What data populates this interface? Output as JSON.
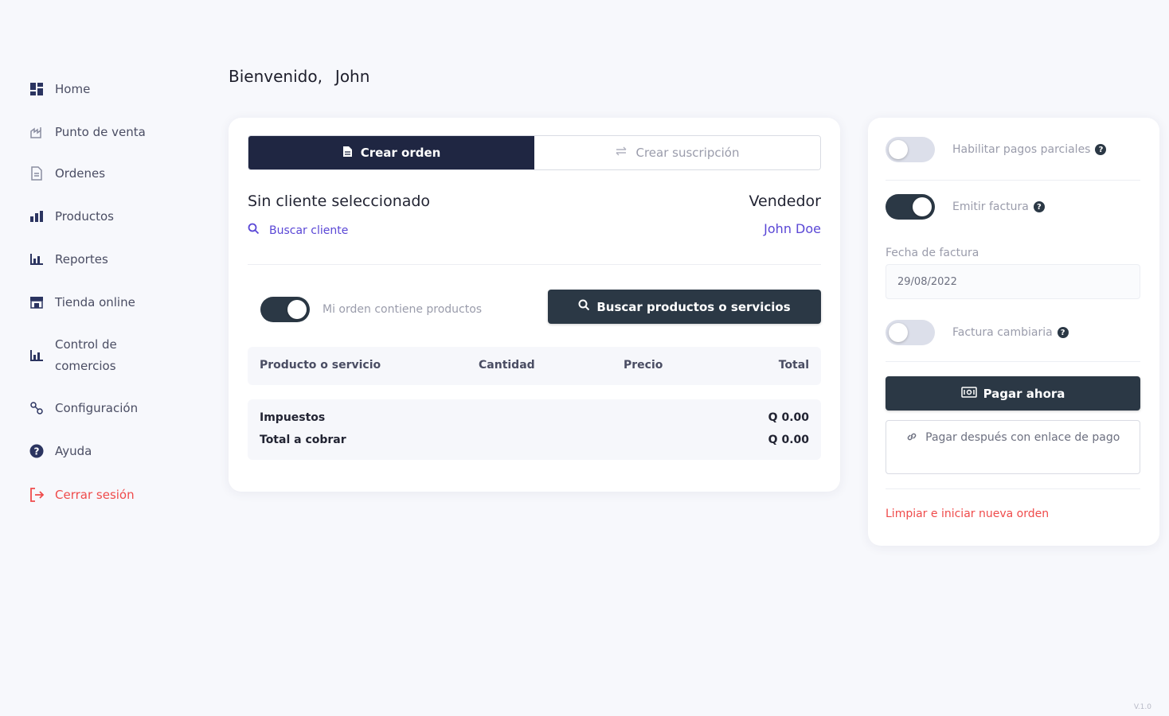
{
  "sidebar": {
    "items": [
      {
        "label": "Home",
        "icon": "dashboard-icon"
      },
      {
        "label": "Punto de venta",
        "icon": "store-icon"
      },
      {
        "label": "Ordenes",
        "icon": "document-icon"
      },
      {
        "label": "Productos",
        "icon": "products-icon"
      },
      {
        "label": "Reportes",
        "icon": "bar-chart-icon"
      },
      {
        "label": "Tienda online",
        "icon": "shop-icon"
      },
      {
        "label": "Control de comercios",
        "icon": "bar-chart-icon"
      },
      {
        "label": "Configuración",
        "icon": "settings-icon"
      },
      {
        "label": "Ayuda",
        "icon": "help-icon"
      },
      {
        "label": "Cerrar sesión",
        "icon": "logout-icon"
      }
    ]
  },
  "header": {
    "greeting": "Bienvenido,",
    "user_name": "John"
  },
  "order": {
    "tabs": [
      {
        "label": "Crear orden",
        "active": true
      },
      {
        "label": "Crear suscripción",
        "active": false
      }
    ],
    "client_status": "Sin cliente seleccionado",
    "search_client": "Buscar cliente",
    "seller_label": "Vendedor",
    "seller_name": "John Doe",
    "contains_products_label": "Mi orden contiene productos",
    "contains_products_on": true,
    "search_products_button": "Buscar productos o servicios",
    "table_headers": [
      "Producto o servicio",
      "Cantidad",
      "Precio",
      "Total"
    ],
    "taxes_label": "Impuestos",
    "taxes_value": "Q 0.00",
    "total_label": "Total a cobrar",
    "total_value": "Q 0.00"
  },
  "options": {
    "partial_payments_label": "Habilitar pagos parciales",
    "partial_payments_on": false,
    "invoice_label": "Emitir factura",
    "invoice_on": true,
    "invoice_date_label": "Fecha de factura",
    "invoice_date_value": "29/08/2022",
    "exchange_invoice_label": "Factura cambiaria",
    "exchange_invoice_on": false,
    "pay_now_button": "Pagar ahora",
    "pay_later_button": "Pagar después con enlace de pago",
    "reset_link": "Limpiar e iniciar nueva orden",
    "help_glyph": "?"
  },
  "colors": {
    "primary_dark": "#1f2642",
    "button_dark": "#2b3845",
    "accent": "#5a47d6",
    "danger": "#ef4b4b"
  },
  "version": "V.1.0"
}
